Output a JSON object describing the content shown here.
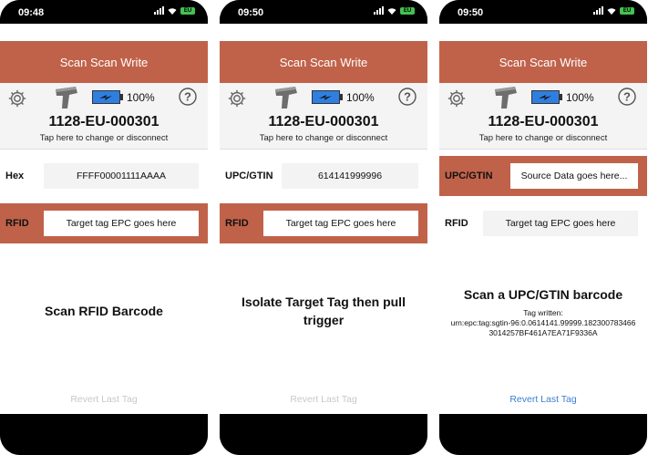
{
  "phones": [
    {
      "time": "09:48",
      "battery_badge": "EU",
      "title": "Scan Scan Write",
      "device_battery": "100%",
      "device_id": "1128-EU-000301",
      "tap_hint": "Tap here to change or disconnect",
      "field1": {
        "label": "Hex",
        "value": "FFFF00001111AAAA",
        "highlighted": false
      },
      "field2": {
        "label": "RFID",
        "value": "Target tag EPC goes here",
        "highlighted": true
      },
      "message": "Scan RFID Barcode",
      "revert": "Revert Last Tag",
      "revert_active": false
    },
    {
      "time": "09:50",
      "battery_badge": "EU",
      "title": "Scan Scan Write",
      "device_battery": "100%",
      "device_id": "1128-EU-000301",
      "tap_hint": "Tap here to change or disconnect",
      "field1": {
        "label": "UPC/GTIN",
        "value": "614141999996",
        "highlighted": false
      },
      "field2": {
        "label": "RFID",
        "value": "Target tag EPC goes here",
        "highlighted": true
      },
      "message": "Isolate Target Tag then pull trigger",
      "revert": "Revert Last Tag",
      "revert_active": false
    },
    {
      "time": "09:50",
      "battery_badge": "EU",
      "title": "Scan Scan Write",
      "device_battery": "100%",
      "device_id": "1128-EU-000301",
      "tap_hint": "Tap here to change or disconnect",
      "field1": {
        "label": "UPC/GTIN",
        "value": "Source Data goes here...",
        "highlighted": true
      },
      "field2": {
        "label": "RFID",
        "value": "Target tag EPC goes here",
        "highlighted": false
      },
      "message": "Scan a UPC/GTIN barcode",
      "tag_written_label": "Tag written:",
      "tag_written_uri": "urn:epc:tag:sgtin-96:0.0614141.99999.182300783466",
      "tag_written_hex": "3014257BF461A7EA71F9336A",
      "revert": "Revert Last Tag",
      "revert_active": true
    }
  ],
  "colors": {
    "accent": "#c0624a",
    "link": "#3c7fd0",
    "battery_green": "#43c24f"
  }
}
